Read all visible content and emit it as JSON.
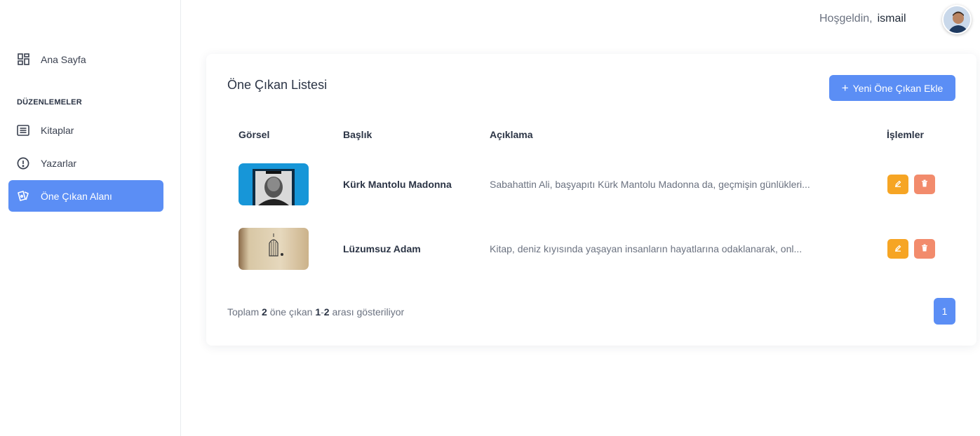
{
  "sidebar": {
    "items": [
      {
        "label": "Ana Sayfa",
        "icon": "dashboard-icon"
      },
      {
        "label": "Kitaplar",
        "icon": "list-icon"
      },
      {
        "label": "Yazarlar",
        "icon": "alert-circle-icon"
      },
      {
        "label": "Öne Çıkan Alanı",
        "icon": "cards-icon"
      }
    ],
    "section_title": "DÜZENLEMELER"
  },
  "topbar": {
    "greeting": "Hoşgeldin,",
    "username": "ismail"
  },
  "card": {
    "title": "Öne Çıkan Listesi",
    "add_button": "Yeni Öne Çıkan Ekle",
    "columns": [
      "Görsel",
      "Başlık",
      "Açıklama",
      "İşlemler"
    ],
    "rows": [
      {
        "title": "Kürk Mantolu Madonna",
        "description": "Sabahattin Ali, başyapıtı Kürk Mantolu Madonna da, geçmişin günlükleri..."
      },
      {
        "title": "Lüzumsuz Adam",
        "description": "Kitap, deniz kıyısında yaşayan insanların hayatlarına odaklanarak, onl..."
      }
    ],
    "footer": {
      "prefix": "Toplam",
      "total": "2",
      "middle": "öne çıkan",
      "range_start": "1",
      "range_sep": "-",
      "range_end": "2",
      "suffix": "arası gösteriliyor"
    },
    "pagination": {
      "current_page": "1"
    }
  },
  "colors": {
    "accent": "#5b8ef5",
    "edit": "#f6a524",
    "delete": "#f28b6c"
  }
}
